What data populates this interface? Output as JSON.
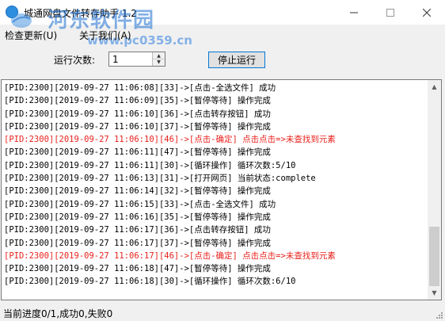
{
  "window": {
    "title": "城通网盘文件转存助手 1.2",
    "watermark_text": "河东软件园",
    "watermark_url": "www.pc0359.cn"
  },
  "menu": {
    "items": [
      {
        "label": "检查更新(U)"
      },
      {
        "label": "关于我们(A)"
      }
    ]
  },
  "controls": {
    "run_count_label": "运行次数:",
    "run_count_value": "1",
    "stop_button_label": "停止运行"
  },
  "log": {
    "lines": [
      {
        "text": "[PID:2300][2019-09-27 11:06:08][33]->[点击-全选文件] 成功",
        "error": false
      },
      {
        "text": "[PID:2300][2019-09-27 11:06:09][35]->[暂停等待] 操作完成",
        "error": false
      },
      {
        "text": "[PID:2300][2019-09-27 11:06:10][36]->[点击转存按钮] 成功",
        "error": false
      },
      {
        "text": "[PID:2300][2019-09-27 11:06:10][37]->[暂停等待] 操作完成",
        "error": false
      },
      {
        "text": "[PID:2300][2019-09-27 11:06:10][46]->[点击-确定] 点击点击=>未查找到元素",
        "error": true
      },
      {
        "text": "[PID:2300][2019-09-27 11:06:11][47]->[暂停等待] 操作完成",
        "error": false
      },
      {
        "text": "[PID:2300][2019-09-27 11:06:11][30]->[循环操作] 循环次数:5/10",
        "error": false
      },
      {
        "text": "[PID:2300][2019-09-27 11:06:13][31]->[打开网页] 当前状态:complete",
        "error": false
      },
      {
        "text": "[PID:2300][2019-09-27 11:06:14][32]->[暂停等待] 操作完成",
        "error": false
      },
      {
        "text": "[PID:2300][2019-09-27 11:06:15][33]->[点击-全选文件] 成功",
        "error": false
      },
      {
        "text": "[PID:2300][2019-09-27 11:06:16][35]->[暂停等待] 操作完成",
        "error": false
      },
      {
        "text": "[PID:2300][2019-09-27 11:06:17][36]->[点击转存按钮] 成功",
        "error": false
      },
      {
        "text": "[PID:2300][2019-09-27 11:06:17][37]->[暂停等待] 操作完成",
        "error": false
      },
      {
        "text": "[PID:2300][2019-09-27 11:06:17][46]->[点击-确定] 点击点击=>未查找到元素",
        "error": true
      },
      {
        "text": "[PID:2300][2019-09-27 11:06:18][47]->[暂停等待] 操作完成",
        "error": false
      },
      {
        "text": "[PID:2300][2019-09-27 11:06:18][30]->[循环操作] 循环次数:6/10",
        "error": false
      }
    ]
  },
  "status": {
    "text": "当前进度0/1,成功0,失败0"
  },
  "colors": {
    "error": "#e8211c",
    "watermark": "#1d6fd0",
    "accent_border": "#0078d7"
  },
  "icons": {
    "app": "app-icon",
    "minimize": "minimize-icon",
    "maximize": "maximize-icon",
    "close": "close-icon"
  }
}
